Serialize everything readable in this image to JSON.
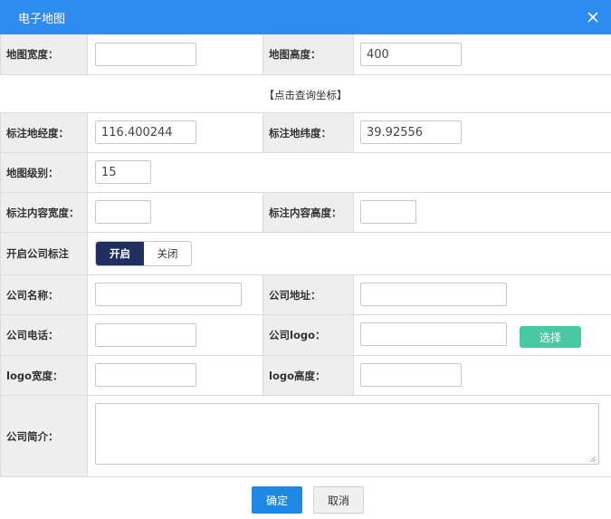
{
  "dialog": {
    "title": "电子地图",
    "close_icon": "close-icon"
  },
  "form": {
    "map_width_label": "地图宽度：",
    "map_width_value": "",
    "map_height_label": "地图高度：",
    "map_height_value": "400",
    "query_coords_link": "【点击查询坐标】",
    "marker_lng_label": "标注地经度：",
    "marker_lng_value": "116.400244",
    "marker_lat_label": "标注地纬度：",
    "marker_lat_value": "39.92556",
    "map_level_label": "地图级别：",
    "map_level_value": "15",
    "content_width_label": "标注内容宽度：",
    "content_width_value": "",
    "content_height_label": "标注内容高度：",
    "content_height_value": "",
    "company_marker_label": "开启公司标注",
    "toggle_on_label": "开启",
    "toggle_off_label": "关闭",
    "toggle_selected": "开启",
    "company_name_label": "公司名称：",
    "company_name_value": "",
    "company_address_label": "公司地址：",
    "company_address_value": "",
    "company_phone_label": "公司电话：",
    "company_phone_value": "",
    "company_logo_label": "公司logo：",
    "company_logo_value": "",
    "select_button_label": "选择",
    "logo_width_label": "logo宽度：",
    "logo_width_value": "",
    "logo_height_label": "logo高度：",
    "logo_height_value": "",
    "company_intro_label": "公司简介：",
    "company_intro_value": ""
  },
  "footer": {
    "ok_label": "确定",
    "cancel_label": "取消"
  },
  "colors": {
    "titlebar": "#2d8cf0",
    "toggle_on": "#1f3060",
    "select_button": "#48c9a0",
    "ok_button": "#1e88e5"
  }
}
